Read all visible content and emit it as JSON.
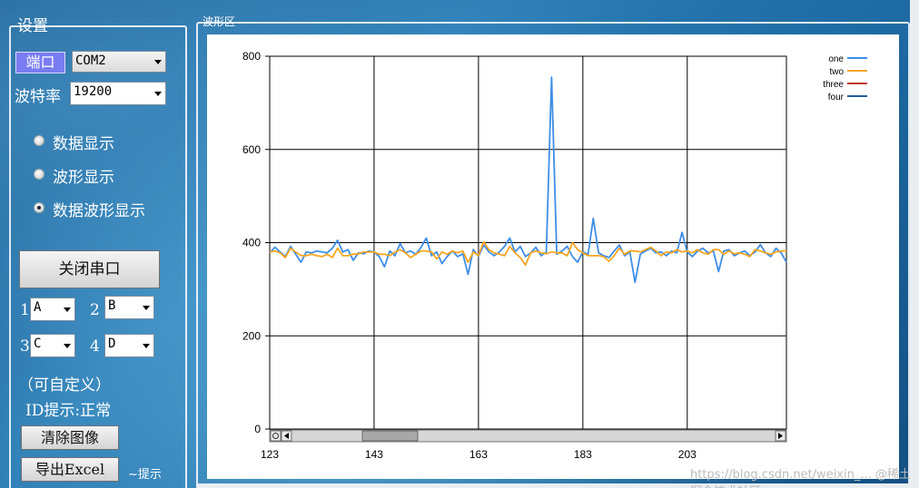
{
  "settings": {
    "title": "设置",
    "port_label": "端口",
    "port_value": "COM2",
    "baud_label": "波特率",
    "baud_value": "19200",
    "radio_options": [
      "数据显示",
      "波形显示",
      "数据波形显示"
    ],
    "selected_radio": 2,
    "close_port_label": "关闭串口",
    "channels": [
      {
        "num": "1",
        "value": "A"
      },
      {
        "num": "2",
        "value": "B"
      },
      {
        "num": "3",
        "value": "C"
      },
      {
        "num": "4",
        "value": "D"
      }
    ],
    "custom_note": "（可自定义）",
    "id_status": "ID提示:正常",
    "clear_label": "清除图像",
    "export_label": "导出Excel",
    "hint_label": "~提示"
  },
  "wave": {
    "title": "波形区"
  },
  "watermark": "https://blog.csdn.net/weixin_... @稀土掘金技术社区",
  "colors": {
    "one": "#3f8ee6",
    "two": "#f5a623",
    "three": "#c0392b",
    "four": "#1f5f99"
  },
  "chart_data": {
    "type": "line",
    "ylim": [
      0,
      800
    ],
    "yticks": [
      0,
      200,
      400,
      600,
      800
    ],
    "xticks": [
      "123",
      "143",
      "163",
      "183",
      "203"
    ],
    "xlim": [
      123,
      222
    ],
    "grid": true,
    "legend_position": "top-right",
    "series": [
      {
        "name": "one",
        "x": [
          123,
          124,
          125,
          126,
          127,
          128,
          129,
          130,
          131,
          132,
          133,
          134,
          135,
          136,
          137,
          138,
          139,
          140,
          141,
          142,
          143,
          144,
          145,
          146,
          147,
          148,
          149,
          150,
          151,
          152,
          153,
          154,
          155,
          156,
          157,
          158,
          159,
          160,
          161,
          162,
          163,
          164,
          165,
          166,
          167,
          168,
          169,
          170,
          171,
          172,
          173,
          174,
          175,
          176,
          177,
          178,
          179,
          180,
          181,
          182,
          183,
          184,
          185,
          186,
          187,
          188,
          189,
          190,
          191,
          192,
          193,
          194,
          195,
          196,
          197,
          198,
          199,
          200,
          201,
          202,
          203,
          204,
          205,
          206,
          207,
          208,
          209,
          210,
          211,
          212,
          213,
          214,
          215,
          216,
          217,
          218,
          219,
          220,
          221,
          222
        ],
        "values": [
          378,
          390,
          380,
          370,
          392,
          375,
          358,
          380,
          378,
          382,
          380,
          378,
          388,
          405,
          380,
          385,
          362,
          378,
          376,
          382,
          380,
          370,
          348,
          382,
          372,
          398,
          378,
          382,
          375,
          390,
          410,
          372,
          380,
          355,
          370,
          382,
          370,
          376,
          332,
          385,
          370,
          395,
          380,
          372,
          380,
          392,
          410,
          380,
          392,
          370,
          378,
          390,
          372,
          380,
          755,
          375,
          382,
          392,
          370,
          358,
          380,
          375,
          452,
          378,
          372,
          368,
          382,
          395,
          372,
          380,
          315,
          375,
          382,
          388,
          378,
          380,
          372,
          382,
          378,
          422,
          380,
          370,
          382,
          388,
          378,
          382,
          338,
          382,
          385,
          372,
          378,
          382,
          372,
          380,
          396,
          378,
          370,
          388,
          378,
          358
        ]
      },
      {
        "name": "two",
        "x": [
          123,
          124,
          125,
          126,
          127,
          128,
          129,
          130,
          131,
          132,
          133,
          134,
          135,
          136,
          137,
          138,
          139,
          140,
          141,
          142,
          143,
          144,
          145,
          146,
          147,
          148,
          149,
          150,
          151,
          152,
          153,
          154,
          155,
          156,
          157,
          158,
          159,
          160,
          161,
          162,
          163,
          164,
          165,
          166,
          167,
          168,
          169,
          170,
          171,
          172,
          173,
          174,
          175,
          176,
          177,
          178,
          179,
          180,
          181,
          182,
          183,
          184,
          185,
          186,
          187,
          188,
          189,
          190,
          191,
          192,
          193,
          194,
          195,
          196,
          197,
          198,
          199,
          200,
          201,
          202,
          203,
          204,
          205,
          206,
          207,
          208,
          209,
          210,
          211,
          212,
          213,
          214,
          215,
          216,
          217,
          218,
          219,
          220,
          221,
          222
        ],
        "values": [
          380,
          382,
          378,
          368,
          388,
          380,
          372,
          372,
          375,
          372,
          370,
          375,
          368,
          388,
          372,
          372,
          375,
          376,
          380,
          380,
          380,
          375,
          375,
          372,
          380,
          385,
          378,
          368,
          375,
          382,
          382,
          380,
          365,
          380,
          375,
          382,
          378,
          382,
          358,
          380,
          372,
          402,
          385,
          378,
          375,
          372,
          392,
          378,
          368,
          352,
          378,
          382,
          378,
          376,
          380,
          378,
          378,
          372,
          400,
          385,
          378,
          372,
          372,
          372,
          370,
          360,
          372,
          388,
          375,
          382,
          382,
          380,
          385,
          390,
          382,
          372,
          380,
          378,
          385,
          380,
          382,
          378,
          385,
          378,
          375,
          385,
          385,
          375,
          382,
          376,
          378,
          375,
          370,
          385,
          382,
          378,
          375,
          380,
          382,
          382
        ]
      },
      {
        "name": "three",
        "x": [],
        "values": []
      },
      {
        "name": "four",
        "x": [],
        "values": []
      }
    ]
  }
}
